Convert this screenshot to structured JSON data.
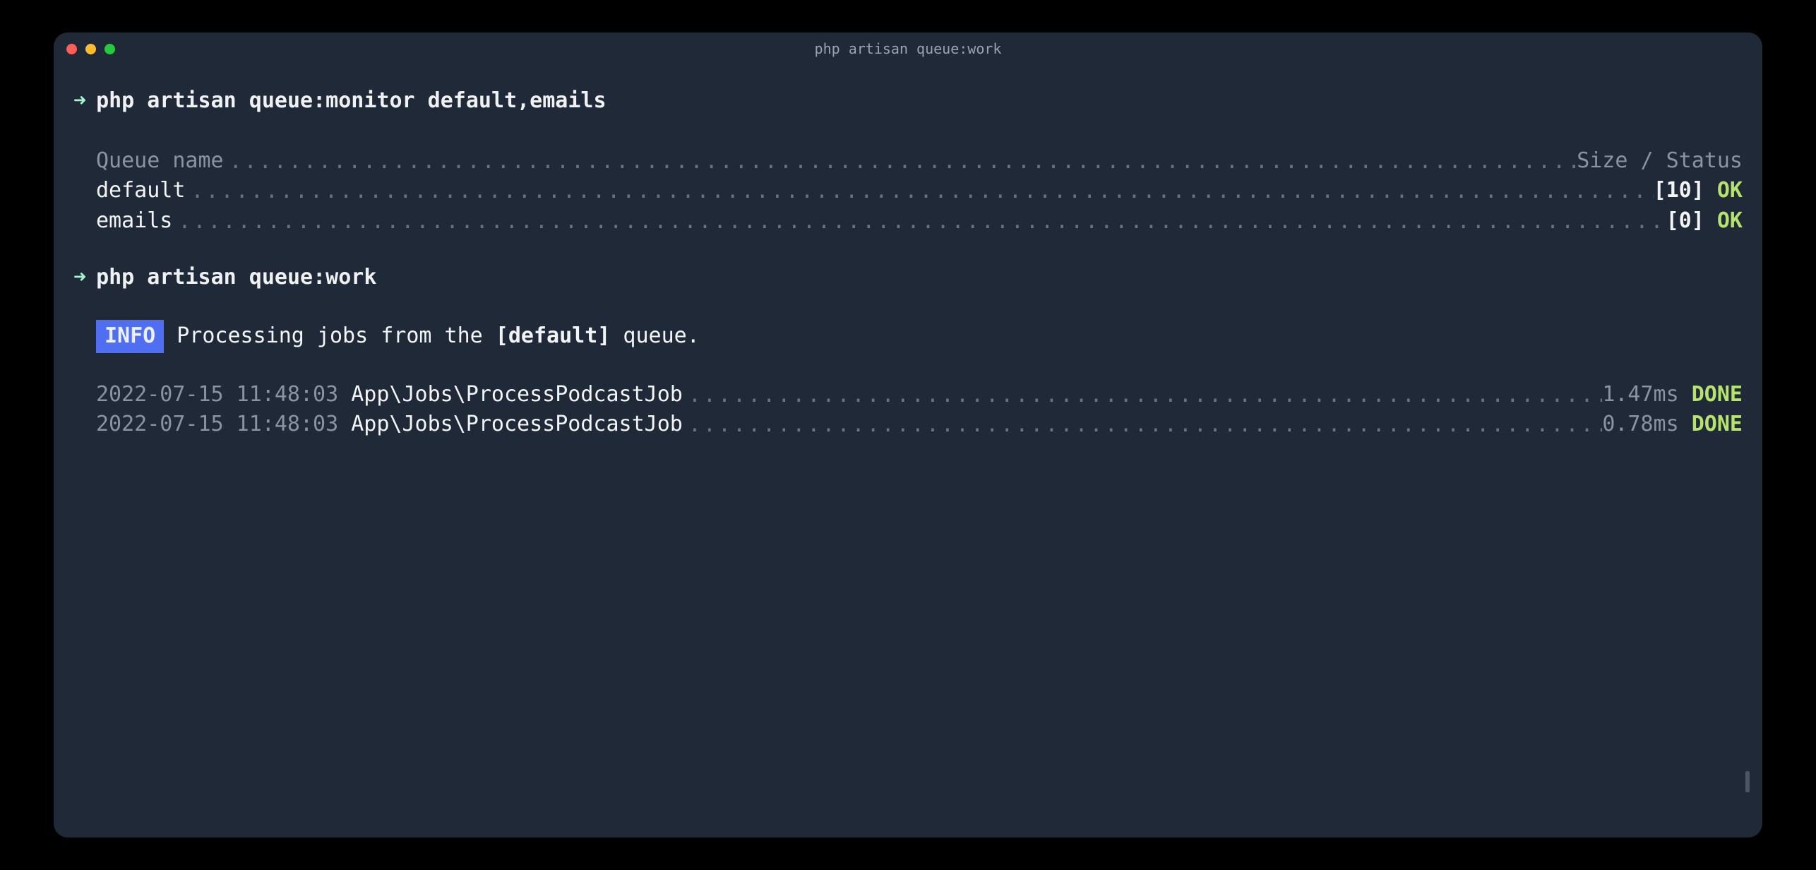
{
  "window": {
    "title": "php artisan queue:work"
  },
  "commands": {
    "monitor": "php artisan queue:monitor default,emails",
    "work": "php artisan queue:work"
  },
  "monitor_header": {
    "left": "Queue name",
    "right": "Size / Status"
  },
  "queues": [
    {
      "name": "default",
      "size": "[10]",
      "status": "OK"
    },
    {
      "name": "emails",
      "size": "[0]",
      "status": "OK"
    }
  ],
  "info": {
    "badge": "INFO",
    "before": "Processing jobs from the ",
    "queue": "[default]",
    "after": " queue."
  },
  "jobs": [
    {
      "ts": "2022-07-15 11:48:03",
      "name": "App\\Jobs\\ProcessPodcastJob",
      "time": "1.47ms",
      "status": "DONE"
    },
    {
      "ts": "2022-07-15 11:48:03",
      "name": "App\\Jobs\\ProcessPodcastJob",
      "time": "0.78ms",
      "status": "DONE"
    }
  ]
}
